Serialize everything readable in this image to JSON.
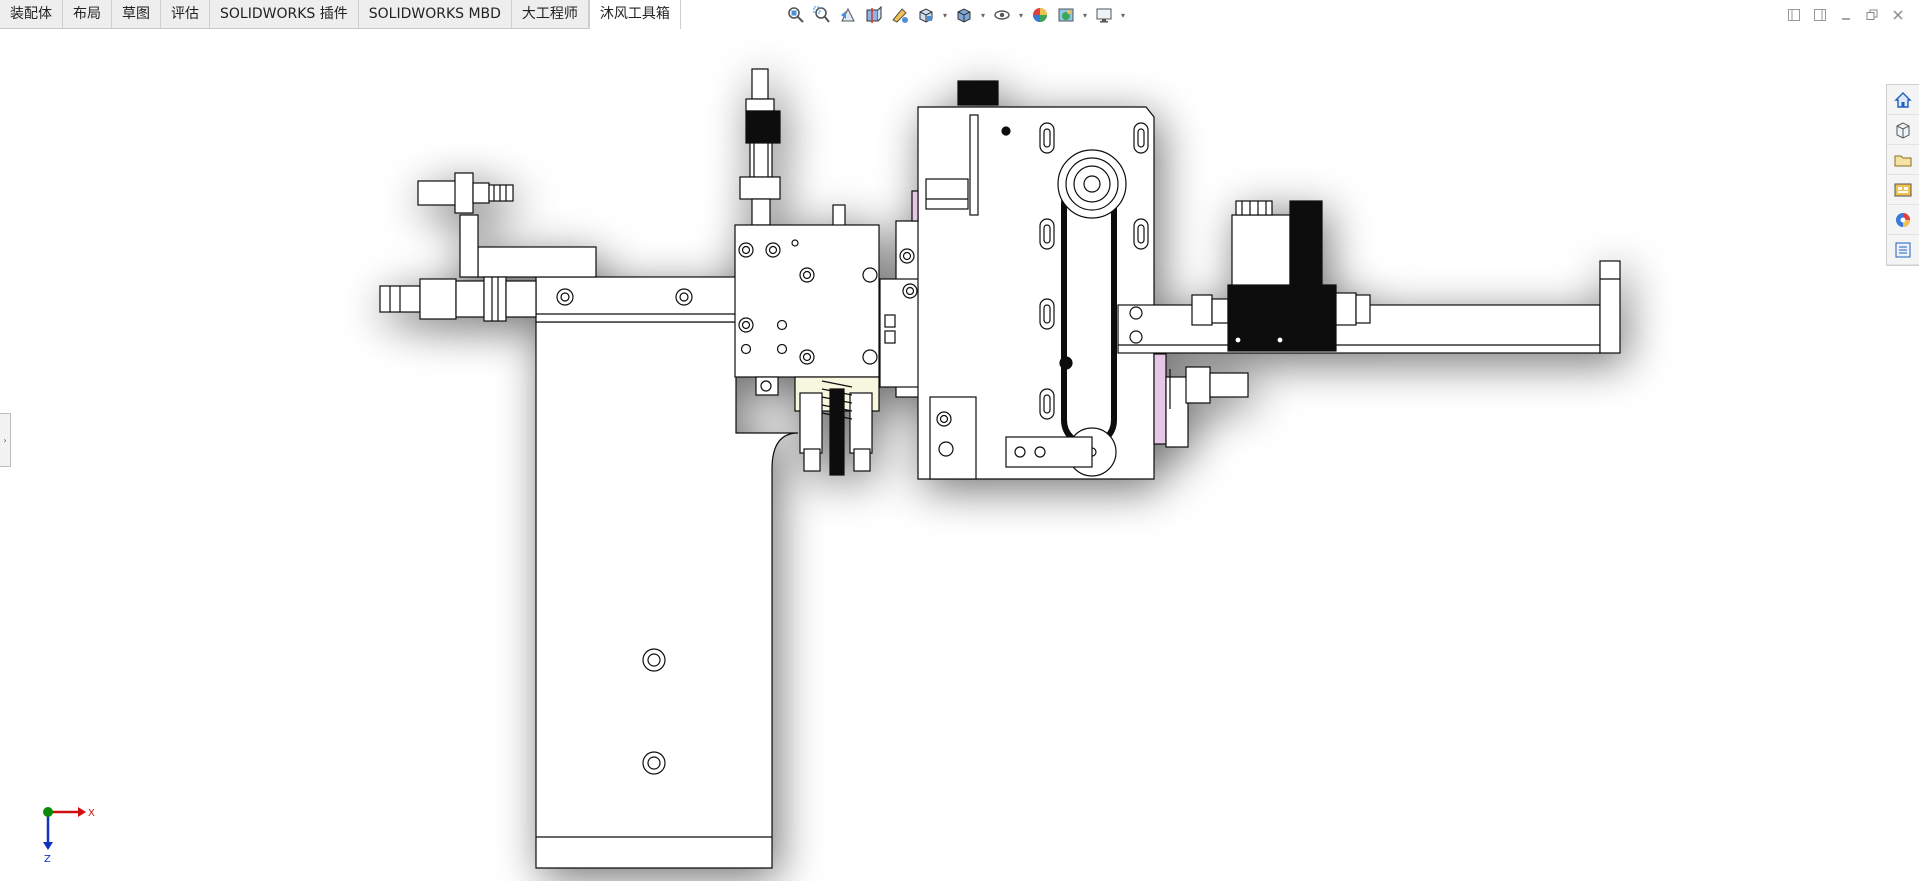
{
  "tabs": [
    {
      "label": "装配体",
      "active": false
    },
    {
      "label": "布局",
      "active": false
    },
    {
      "label": "草图",
      "active": false
    },
    {
      "label": "评估",
      "active": false
    },
    {
      "label": "SOLIDWORKS 插件",
      "active": false
    },
    {
      "label": "SOLIDWORKS MBD",
      "active": false
    },
    {
      "label": "大工程师",
      "active": false
    },
    {
      "label": "沐风工具箱",
      "active": true
    }
  ],
  "triad": {
    "x_label": "X",
    "z_label": "Z"
  },
  "colors": {
    "accent": "#1f5fbf",
    "axis_x": "#d01010",
    "axis_y": "#0a8a0a",
    "axis_z": "#1030c0",
    "tab_bg": "#eeeeee"
  },
  "hud_icons": [
    "zoom-to-fit-icon",
    "zoom-to-area-icon",
    "previous-view-icon",
    "section-view-icon",
    "dynamic-annotation-icon",
    "view-orientation-icon",
    "display-style-icon",
    "hide-show-items-icon",
    "edit-appearance-icon",
    "apply-scene-icon",
    "view-settings-icon"
  ],
  "taskpane_icons": [
    "solidworks-resources-icon",
    "design-library-icon",
    "file-explorer-icon",
    "view-palette-icon",
    "appearances-scenes-icon",
    "custom-properties-icon"
  ]
}
